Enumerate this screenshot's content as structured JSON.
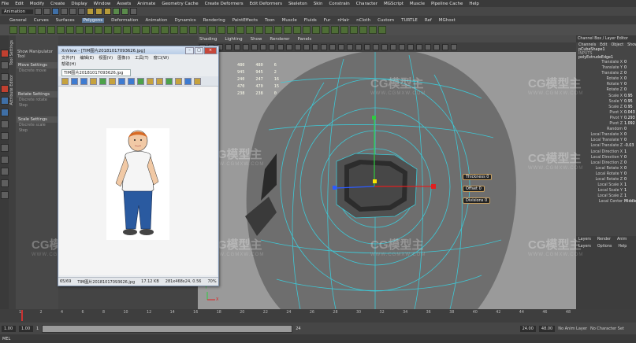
{
  "menubar": [
    "File",
    "Edit",
    "Modify",
    "Create",
    "Display",
    "Window",
    "Assets",
    "Animate",
    "Geometry Cache",
    "Create Deformers",
    "Edit Deformers",
    "Skeleton",
    "Skin",
    "Constrain",
    "Character",
    "MGScript",
    "Muscle",
    "Pipeline Cache",
    "Help"
  ],
  "status_line": {
    "menu_set": "Animation"
  },
  "shelf_tabs": [
    "General",
    "Curves",
    "Surfaces",
    "Polygons",
    "Deformation",
    "Animation",
    "Dynamics",
    "Rendering",
    "PaintEffects",
    "Toon",
    "Muscle",
    "Fluids",
    "Fur",
    "nHair",
    "nCloth",
    "Custom",
    "TURTLE",
    "Ref",
    "MGhost"
  ],
  "shelf_active": "Polygons",
  "tool_settings": {
    "header": "Show Manipulator Tool",
    "sections": [
      {
        "label": "Move Settings",
        "sub": [
          "Discrete move"
        ]
      },
      {
        "label": "Rotate Settings",
        "sub": [
          "Discrete rotate",
          "Step"
        ]
      },
      {
        "label": "Scale Settings",
        "sub": [
          "Discrete scale",
          "Step"
        ]
      }
    ],
    "side_tabs": [
      "Tool Settings",
      "Attribute Editor"
    ]
  },
  "viewport": {
    "menu": [
      "Shading",
      "Lighting",
      "Show",
      "Renderer",
      "Panels"
    ],
    "hud": [
      [
        "480",
        "480",
        "6"
      ],
      [
        "945",
        "945",
        "2"
      ],
      [
        "240",
        "247",
        "16"
      ],
      [
        "470",
        "470",
        "15"
      ],
      [
        "238",
        "238",
        "0"
      ]
    ],
    "attr_labels": [
      "Thickness 0",
      "Offset 0",
      "Divisions 0"
    ],
    "axis": {
      "y": "Y",
      "x": "X"
    }
  },
  "xnview": {
    "title": "XnView - [TIM图片20181017093626.jpg]",
    "menu": [
      "文件(F)",
      "编辑(E)",
      "视图(V)",
      "图像(I)",
      "工具(T)",
      "窗口(W)"
    ],
    "menu2": "帮助(H)",
    "tab": "TIM图片20181017093626.jpg",
    "status": [
      "65/69",
      "TIM图片20181017093626.jpg",
      "17.12 KB",
      "281x468x24, 0.56",
      "70%"
    ]
  },
  "channel_box": {
    "title": "Channel Box / Layer Editor",
    "menu": [
      "Channels",
      "Edit",
      "Object",
      "Show"
    ],
    "object": "pCubeShape1",
    "inputs": "INPUTS",
    "node": "polyExtrudeEdge1",
    "attrs": [
      {
        "name": "Translate X",
        "value": "0"
      },
      {
        "name": "Translate Y",
        "value": "0"
      },
      {
        "name": "Translate Z",
        "value": "0"
      },
      {
        "name": "Rotate X",
        "value": "0"
      },
      {
        "name": "Rotate Y",
        "value": "0"
      },
      {
        "name": "Rotate Z",
        "value": "0"
      },
      {
        "name": "Scale X",
        "value": "0.95"
      },
      {
        "name": "Scale Y",
        "value": "0.95"
      },
      {
        "name": "Scale Z",
        "value": "0.95"
      },
      {
        "name": "Pivot X",
        "value": "0.043"
      },
      {
        "name": "Pivot Y",
        "value": "0.293"
      },
      {
        "name": "Pivot Z",
        "value": "1.092"
      },
      {
        "name": "Random",
        "value": "0"
      },
      {
        "name": "Local Translate X",
        "value": "0"
      },
      {
        "name": "Local Translate Y",
        "value": "0"
      },
      {
        "name": "Local Translate Z",
        "value": "-0.03"
      },
      {
        "name": "Local Direction X",
        "value": "1"
      },
      {
        "name": "Local Direction Y",
        "value": "0"
      },
      {
        "name": "Local Direction Z",
        "value": "0"
      },
      {
        "name": "Local Rotate X",
        "value": "0"
      },
      {
        "name": "Local Rotate Y",
        "value": "0"
      },
      {
        "name": "Local Rotate Z",
        "value": "0"
      },
      {
        "name": "Local Scale X",
        "value": "1"
      },
      {
        "name": "Local Scale Y",
        "value": "1"
      },
      {
        "name": "Local Scale Z",
        "value": "1"
      },
      {
        "name": "Local Center",
        "value": "Middle"
      }
    ],
    "lower_tabs": [
      "Layers",
      "Render",
      "Anim"
    ],
    "lower_menu": [
      "Layers",
      "Options",
      "Help"
    ]
  },
  "time_slider": {
    "ticks": [
      "1",
      "2",
      "4",
      "6",
      "8",
      "10",
      "12",
      "14",
      "16",
      "18",
      "20",
      "22",
      "24",
      "26",
      "28",
      "30",
      "32",
      "34",
      "36",
      "38",
      "40",
      "42",
      "44",
      "46",
      "48"
    ]
  },
  "range": {
    "start": "1.00",
    "current": "1.00",
    "slider_value": "1",
    "end_value": "24",
    "anim_end": "24.00",
    "max": "48.00",
    "layer": "No Anim Layer",
    "char": "No Character Set"
  },
  "help_line": "MEL",
  "watermark": {
    "text": "CG模型主",
    "url": "WWW.CGMXW.COM"
  },
  "colors": {
    "mesh": "#3ec8d6",
    "accent": "#59789c"
  }
}
